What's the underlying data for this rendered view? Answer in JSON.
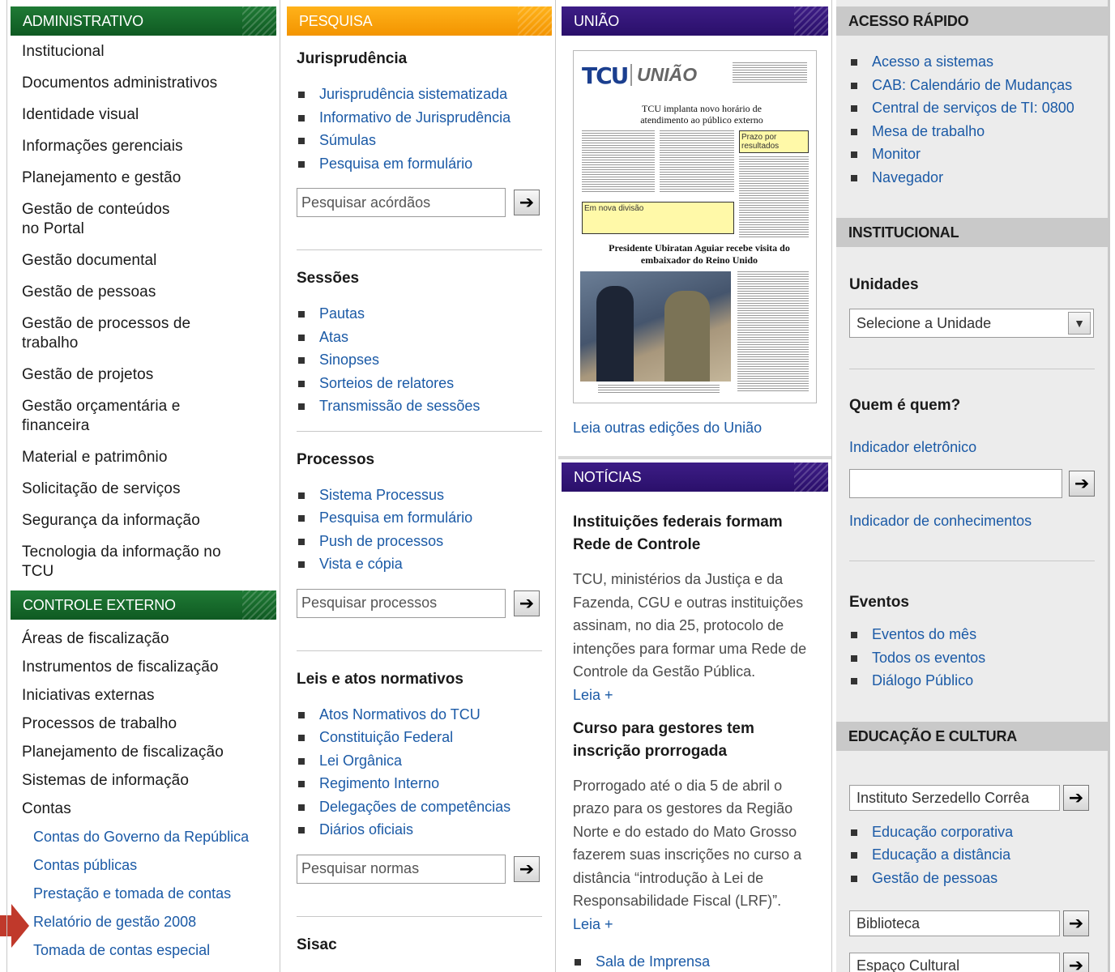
{
  "administrativo": {
    "header": "ADMINISTRATIVO",
    "items": [
      "Institucional",
      "Documentos administrativos",
      "Identidade visual",
      "Informações gerenciais",
      "Planejamento e gestão",
      "Gestão de conteúdos\nno Portal",
      "Gestão documental",
      "Gestão de pessoas",
      "Gestão de processos de\ntrabalho",
      "Gestão de projetos",
      "Gestão orçamentária e\nfinanceira",
      "Material e patrimônio",
      "Solicitação de serviços",
      "Segurança da informação",
      "Tecnologia da informação no\nTCU"
    ]
  },
  "controle_externo": {
    "header": "CONTROLE EXTERNO",
    "items": [
      "Áreas de fiscalização",
      "Instrumentos de fiscalização",
      "Iniciativas externas",
      "Processos de trabalho",
      "Planejamento de fiscalização",
      "Sistemas de informação",
      "Contas"
    ],
    "subitems": [
      "Contas do Governo da República",
      "Contas públicas",
      "Prestação e tomada de contas",
      "Relatório de gestão 2008",
      "Tomada de contas especial"
    ]
  },
  "pesquisa": {
    "header": "PESQUISA",
    "jurisprudencia": {
      "title": "Jurisprudência",
      "links": [
        "Jurisprudência sistematizada",
        "Informativo de Jurisprudência",
        "Súmulas",
        "Pesquisa em formulário"
      ],
      "placeholder": "Pesquisar acórdãos"
    },
    "sessoes": {
      "title": "Sessões",
      "links": [
        "Pautas",
        "Atas",
        "Sinopses",
        "Sorteios de relatores",
        "Transmissão de sessões"
      ]
    },
    "processos": {
      "title": "Processos",
      "links": [
        "Sistema Processus",
        "Pesquisa em formulário",
        "Push de processos",
        "Vista e cópia"
      ],
      "placeholder": "Pesquisar processos"
    },
    "leis": {
      "title": "Leis e atos normativos",
      "links": [
        "Atos Normativos do TCU",
        "Constituição Federal",
        "Lei Orgânica",
        "Regimento Interno",
        "Delegações de competências",
        "Diários oficiais"
      ],
      "placeholder": "Pesquisar normas"
    },
    "sisac": {
      "title": "Sisac"
    }
  },
  "uniao": {
    "header": "UNIÃO",
    "paper": {
      "logo": "TCU",
      "logo2": "UNIÃO",
      "headline1": "TCU implanta novo horário de atendimento ao público externo",
      "box1": "Prazo por resultados",
      "box2": "Em nova divisão",
      "headline2": "Presidente Ubiratan Aguiar recebe visita do embaixador do Reino Unido"
    },
    "link": "Leia outras edições do União"
  },
  "noticias": {
    "header": "NOTÍCIAS",
    "items": [
      {
        "title": "Instituições federais formam Rede de Controle",
        "body": "TCU, ministérios da Justiça e da Fazenda, CGU e outras instituições assinam, no dia 25, protocolo de intenções para formar uma Rede de Controle da Gestão Pública.",
        "more": "Leia +"
      },
      {
        "title": "Curso para gestores tem inscrição prorrogada",
        "body": "Prorrogado até o dia 5 de abril o prazo para os gestores da Região Norte e do estado do Mato Grosso fazerem suas inscrições no curso a distância “introdução à Lei de Responsabilidade Fiscal (LRF)”.",
        "more": "Leia +"
      }
    ],
    "extra_link": "Sala de Imprensa"
  },
  "acesso_rapido": {
    "header": "ACESSO RÁPIDO",
    "links": [
      "Acesso a sistemas",
      "CAB: Calendário de Mudanças",
      "Central de serviços de TI: 0800",
      "Mesa de trabalho",
      "Monitor",
      "Navegador"
    ]
  },
  "institucional": {
    "header": "INSTITUCIONAL",
    "unidades_title": "Unidades",
    "select_value": "Selecione a Unidade",
    "quem_title": "Quem é quem?",
    "indicador_eletronico": "Indicador eletrônico",
    "indicador_conhecimentos": "Indicador de conhecimentos",
    "eventos_title": "Eventos",
    "eventos_links": [
      "Eventos do mês",
      "Todos os eventos",
      "Diálogo Público"
    ]
  },
  "educacao": {
    "header": "EDUCAÇÃO E CULTURA",
    "combo1": "Instituto Serzedello Corrêa",
    "links": [
      "Educação corporativa",
      "Educação a distância",
      "Gestão de pessoas"
    ],
    "combo2": "Biblioteca",
    "combo3": "Espaço Cultural"
  },
  "icons": {
    "go": "arrow-right-icon",
    "marker": "red-arrow-marker-icon",
    "dropdown": "chevron-down-icon"
  },
  "colors": {
    "green": "#1f7a35",
    "orange": "#f39400",
    "purple": "#2a0f6a",
    "gray_header": "#c9c9c9",
    "link": "#1b5aa6",
    "marker": "#c0392b"
  }
}
